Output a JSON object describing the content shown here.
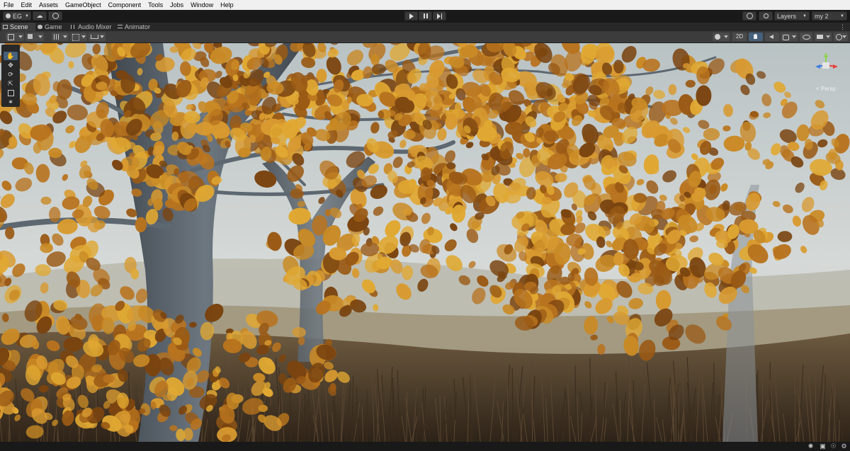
{
  "menu": [
    "File",
    "Edit",
    "Assets",
    "GameObject",
    "Component",
    "Tools",
    "Jobs",
    "Window",
    "Help"
  ],
  "toolbar": {
    "account_label": "EG",
    "play_icon": "play-icon",
    "pause_icon": "pause-icon",
    "step_icon": "step-icon",
    "layers_label": "Layers",
    "layout_label": "my 2"
  },
  "tabs": [
    {
      "label": "Scene",
      "active": true
    },
    {
      "label": "Game",
      "active": false
    },
    {
      "label": "Audio Mixer",
      "active": false
    },
    {
      "label": "Animator",
      "active": false
    }
  ],
  "scene_toolbar": {
    "mode_2d": "2D"
  },
  "viewport": {
    "projection_label": "< Persp",
    "gizmo_axes": {
      "x": "#e8433a",
      "y": "#8fd14f",
      "z": "#3f7fe2"
    }
  },
  "colors": {
    "accent": "#46607c",
    "foliage_dark": "#7a4410",
    "foliage": "#b8731e",
    "foliage_light": "#e0a832",
    "bark": "#5c6670",
    "sky": "#cdd3d3",
    "grass": "#4a3826"
  }
}
